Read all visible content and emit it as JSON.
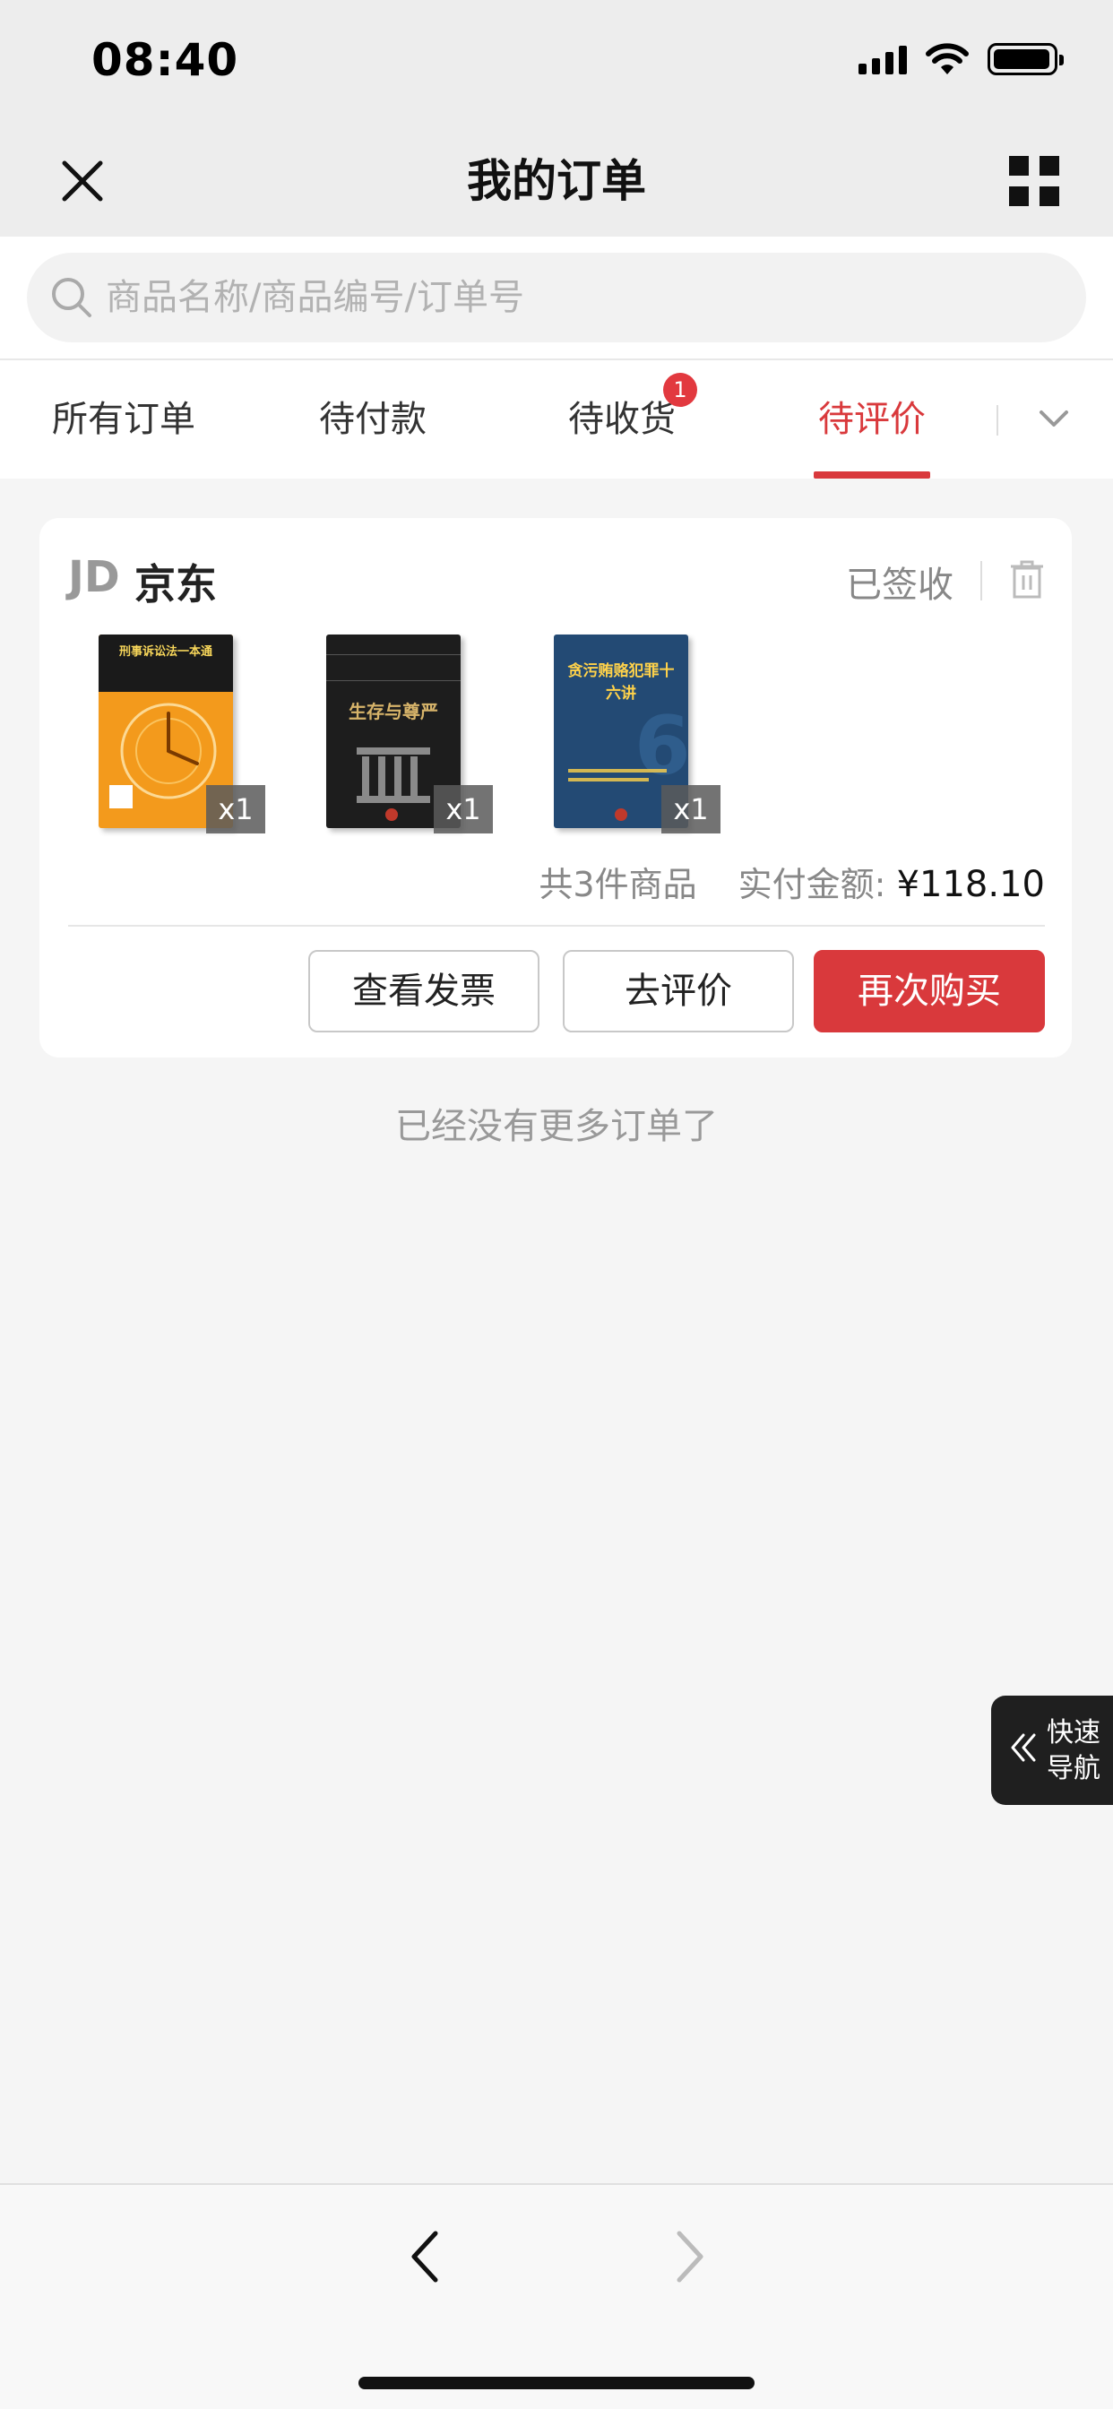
{
  "status_bar": {
    "time": "08:40"
  },
  "header": {
    "title": "我的订单"
  },
  "search": {
    "placeholder": "商品名称/商品编号/订单号"
  },
  "tabs": [
    {
      "label": "所有订单",
      "active": false
    },
    {
      "label": "待付款",
      "active": false
    },
    {
      "label": "待收货",
      "active": false,
      "badge": "1"
    },
    {
      "label": "待评价",
      "active": true
    }
  ],
  "order": {
    "shop_logo": "JD",
    "shop_name": "京东",
    "status": "已签收",
    "products": [
      {
        "quantity": "x1",
        "cover_title": "刑事诉讼法一本通",
        "cover_color": "#f39a1c"
      },
      {
        "quantity": "x1",
        "cover_title": "生存与尊严",
        "cover_color": "#1d1d1d"
      },
      {
        "quantity": "x1",
        "cover_title": "贪污贿赂犯罪十六讲",
        "cover_color": "#234a74"
      }
    ],
    "item_count_text": "共3件商品",
    "paid_label": "实付金额:",
    "paid_amount": "¥118.10",
    "actions": {
      "invoice": "查看发票",
      "review": "去评价",
      "rebuy": "再次购买"
    }
  },
  "end_text": "已经没有更多订单了",
  "quick_nav": {
    "line1": "快速",
    "line2": "导航"
  },
  "colors": {
    "accent": "#d9393c",
    "background": "#f5f5f5"
  }
}
